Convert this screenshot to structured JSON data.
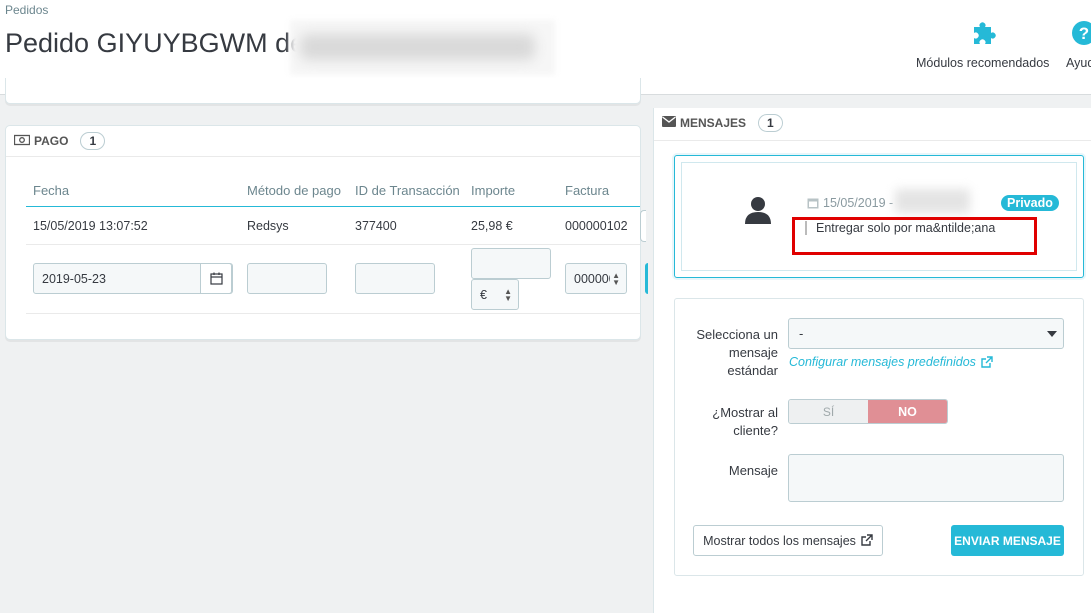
{
  "header": {
    "breadcrumb": "Pedidos",
    "title": "Pedido GIYUYBGWM de",
    "toolbar": [
      {
        "label": "Módulos recomendados",
        "icon": "puzzle-icon"
      },
      {
        "label": "Ayuda",
        "icon": "help-icon"
      }
    ]
  },
  "payment": {
    "heading": "PAGO",
    "count": "1",
    "columns": [
      "Fecha",
      "Método de pago",
      "ID de Transacción",
      "Importe",
      "Factura"
    ],
    "rows": [
      {
        "date": "15/05/2019 13:07:52",
        "method": "Redsys",
        "transaction_id": "377400",
        "amount": "25,98 €",
        "invoice": "000000102"
      }
    ],
    "form": {
      "date_value": "2019-05-23",
      "currency": "€",
      "invoice_value": "000000"
    }
  },
  "messages": {
    "heading": "MENSAJES",
    "count": "1",
    "item": {
      "date": "15/05/2019 -",
      "badge": "Privado",
      "text": "Entregar solo por ma&ntilde;ana"
    },
    "form": {
      "standard_label": "Selecciona un mensaje estándar",
      "standard_value": "-",
      "configure_link": "Configurar mensajes predefinidos",
      "show_label": "¿Mostrar al cliente?",
      "toggle_yes": "SÍ",
      "toggle_no": "NO",
      "message_label": "Mensaje",
      "show_all_button": "Mostrar todos los mensajes",
      "send_button": "ENVIAR MENSAJE"
    }
  },
  "colors": {
    "accent": "#25b9d7",
    "toggle_no": "#e08f95",
    "highlight": "#e00000"
  }
}
